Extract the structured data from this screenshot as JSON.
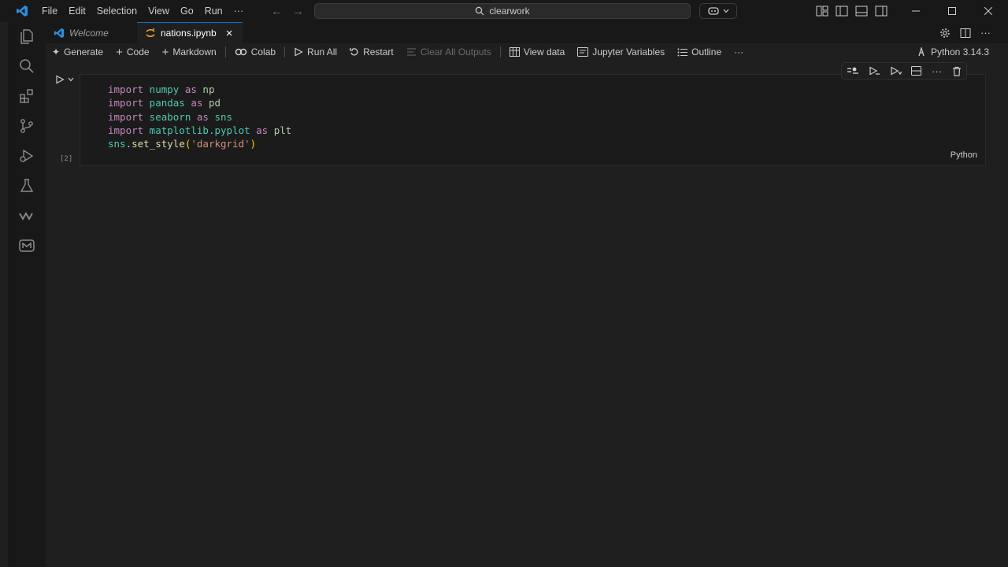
{
  "menubar": {
    "items": [
      "File",
      "Edit",
      "Selection",
      "View",
      "Go",
      "Run",
      "···"
    ]
  },
  "command_center": {
    "text": "clearwork",
    "icon": "search-icon"
  },
  "tabs": [
    {
      "label": "Welcome",
      "icon": "vscode-icon",
      "active": false
    },
    {
      "label": "nations.ipynb",
      "icon": "jupyter-icon",
      "active": true
    }
  ],
  "toolbar": {
    "generate": "Generate",
    "code": "Code",
    "markdown": "Markdown",
    "colab": "Colab",
    "run_all": "Run All",
    "restart": "Restart",
    "clear_outputs": "Clear All Outputs",
    "view_data": "View data",
    "jupyter_variables": "Jupyter Variables",
    "outline": "Outline",
    "more": "···",
    "kernel": "Python 3.14.3"
  },
  "cell": {
    "execution_count": "[2]",
    "language": "Python",
    "lines": [
      [
        {
          "t": "import",
          "c": "kw"
        },
        {
          "t": " numpy ",
          "c": "mod"
        },
        {
          "t": "as",
          "c": "kw"
        },
        {
          "t": " np",
          "c": "al"
        }
      ],
      [
        {
          "t": "import",
          "c": "kw"
        },
        {
          "t": " pandas ",
          "c": "mod"
        },
        {
          "t": "as",
          "c": "kw"
        },
        {
          "t": " pd",
          "c": "al"
        }
      ],
      [
        {
          "t": "import",
          "c": "kw"
        },
        {
          "t": " seaborn ",
          "c": "mod"
        },
        {
          "t": "as",
          "c": "kw"
        },
        {
          "t": " sns",
          "c": "mod"
        }
      ],
      [
        {
          "t": "import",
          "c": "kw"
        },
        {
          "t": " matplotlib.pyplot ",
          "c": "mod"
        },
        {
          "t": "as",
          "c": "kw"
        },
        {
          "t": " plt",
          "c": "al"
        }
      ],
      [
        {
          "t": "sns",
          "c": "mod"
        },
        {
          "t": ".",
          "c": "id"
        },
        {
          "t": "set_style",
          "c": "fn"
        },
        {
          "t": "(",
          "c": "br"
        },
        {
          "t": "'darkgrid'",
          "c": "str"
        },
        {
          "t": ")",
          "c": "br"
        }
      ]
    ]
  },
  "colors": {
    "background": "#1f1f1f",
    "sidebar": "#181818",
    "accent": "#0078d4"
  }
}
